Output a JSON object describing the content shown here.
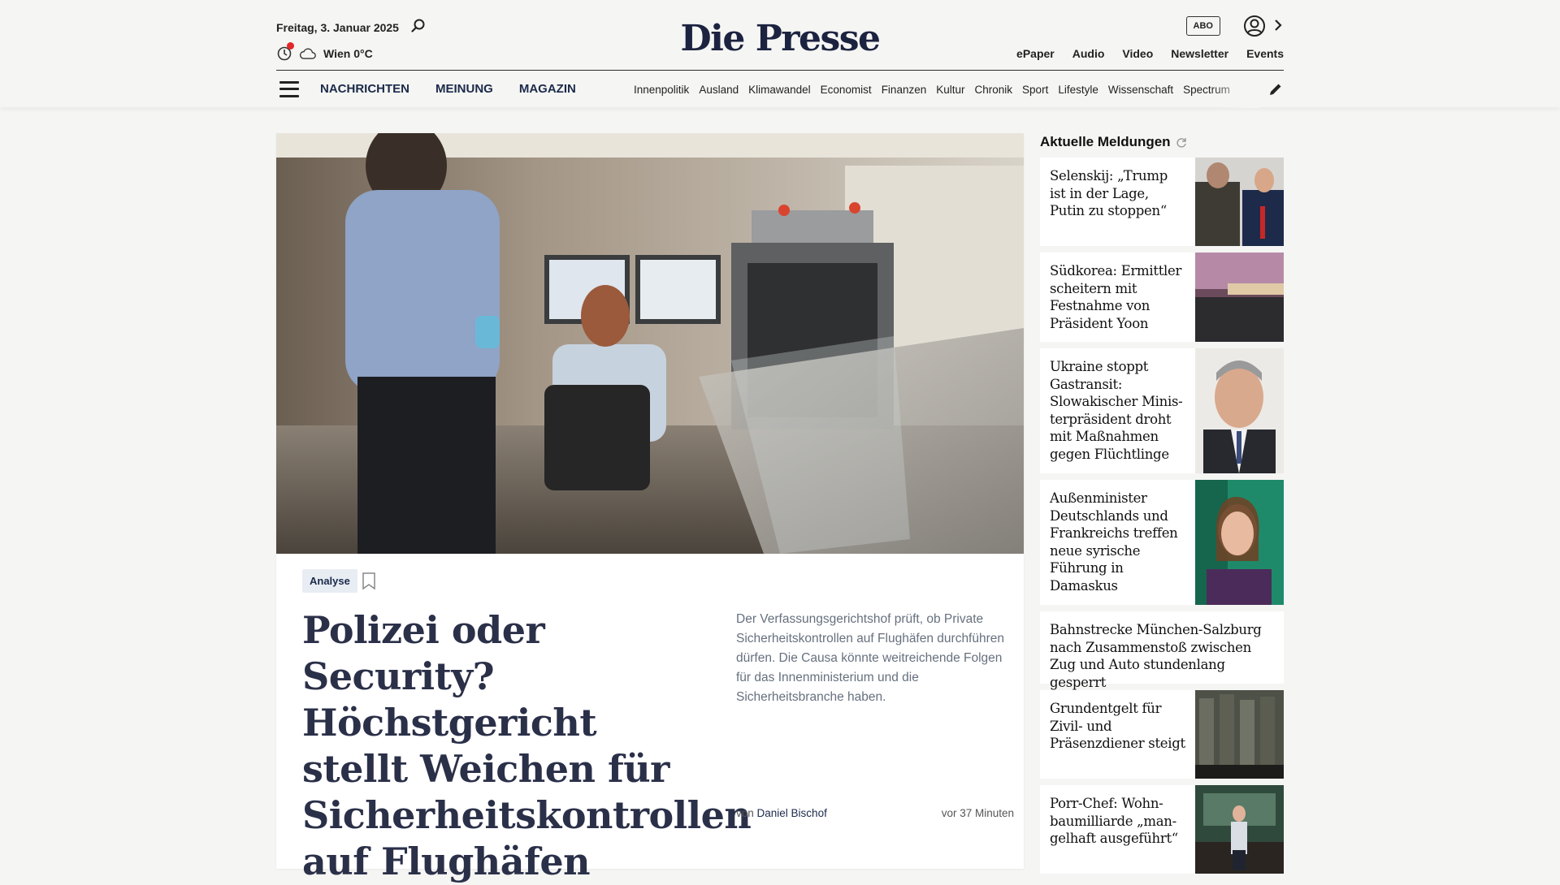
{
  "header": {
    "date": "Freitag, 3. Januar 2025",
    "weather": "Wien 0°C",
    "logo": "Die Presse",
    "abo": "ABO",
    "toplinks": [
      "ePaper",
      "Audio",
      "Video",
      "Newsletter",
      "Events"
    ]
  },
  "nav": {
    "main": [
      "NACHRICHTEN",
      "MEINUNG",
      "MAGAZIN"
    ],
    "sub": [
      "Innenpolitik",
      "Ausland",
      "Klimawandel",
      "Economist",
      "Finanzen",
      "Kultur",
      "Chronik",
      "Sport",
      "Lifestyle",
      "Wissenschaft",
      "Spectrum"
    ]
  },
  "hero": {
    "tag": "Analyse",
    "headline": "Polizei oder Security? Höchstgericht stellt Weichen für Sicherheitskontrollen auf Flughäfen",
    "teaser": "Der Verfassungsgerichtshof prüft, ob Private Sicherheitskontrollen auf Flughäfen durchführen dürfen. Die Causa könnte weitreichende Folgen für das Innenministerium und die Sicherheitsbranche haben.",
    "byline_prefix": "von ",
    "author": "Daniel Bischof",
    "time": "vor 37 Minuten"
  },
  "sidebar": {
    "title": "Aktuelle Meldungen",
    "items": [
      {
        "text": "Selenskij: „Trump ist in der Lage, Putin zu stoppen“"
      },
      {
        "text": "Südkorea: Ermittler scheitern mit Festnahme von Präsident Yoon"
      },
      {
        "text": "Ukraine stoppt Gastransit: Slowakischer Minis­terpräsident droht mit Maßnahmen gegen Flüchtlinge"
      },
      {
        "text": "Außenminister Deutschlands und Frankreichs treffen neue syrische Führung in Damaskus"
      },
      {
        "text": "Bahnstrecke München-Salzburg nach Zusammenstoß zwischen Zug und Auto stundenlang gesperrt"
      },
      {
        "text": "Grundentgelt für Zivil- und Präsenzdiener steigt"
      },
      {
        "text": "Porr-Chef: Wohn­baumilliarde „man­gelhaft ausgeführt“"
      }
    ]
  },
  "colors": {
    "accent": "#1b2a4a",
    "notification": "#e3262b",
    "headline": "#2b3049"
  }
}
